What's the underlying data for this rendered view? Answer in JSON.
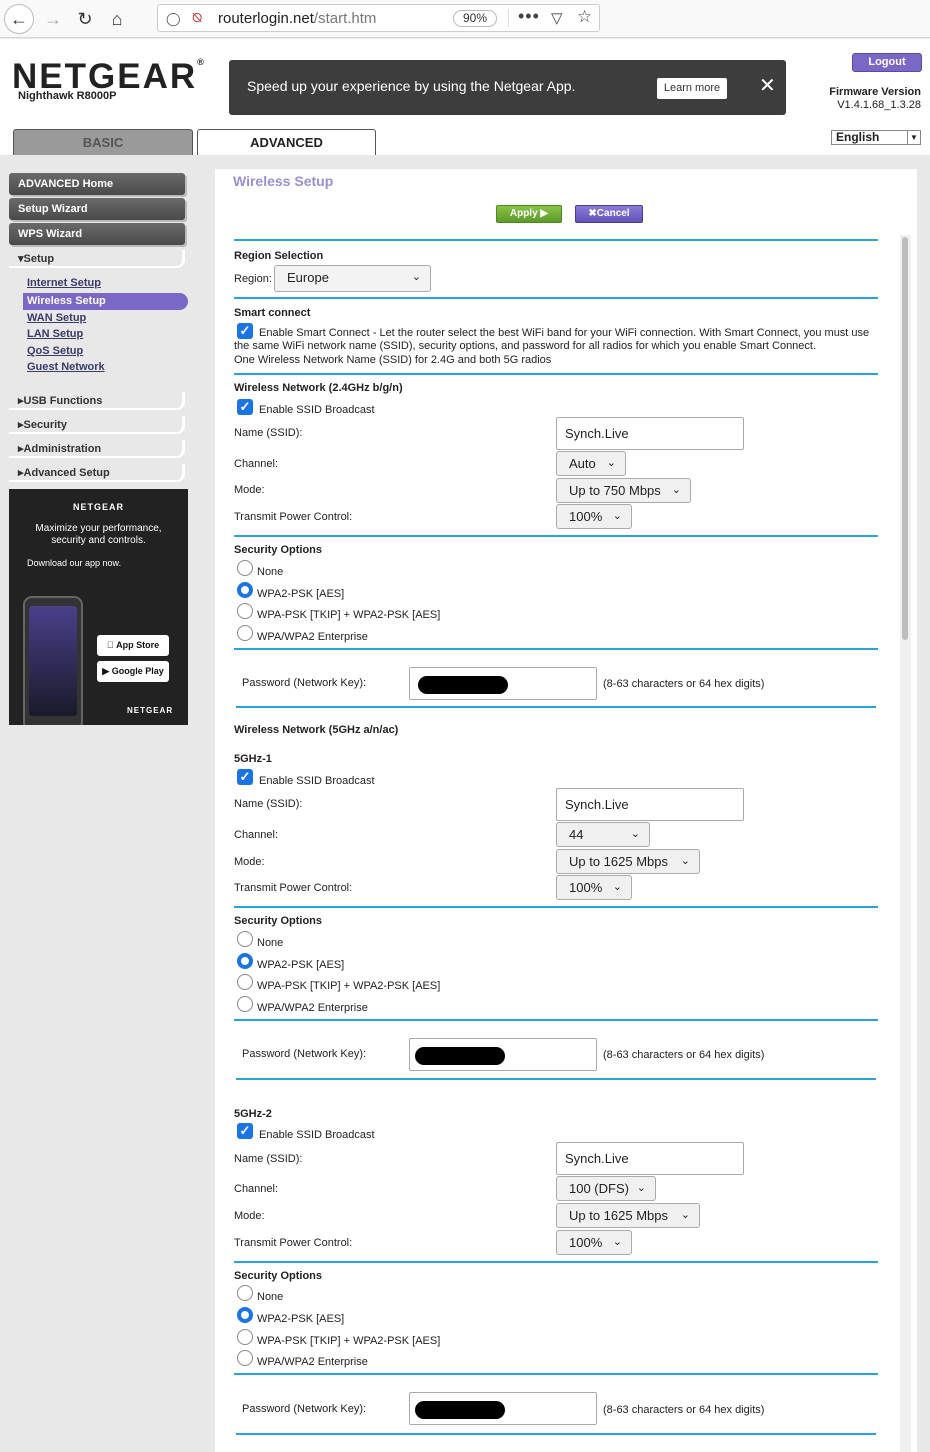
{
  "browser": {
    "url_host": "routerlogin.net",
    "url_path": "/start.htm",
    "zoom": "90%",
    "icons": [
      "back-icon",
      "forward-icon",
      "reload-icon",
      "home-icon",
      "shield-icon",
      "insecure-lock-icon",
      "more-icon",
      "pocket-icon",
      "star-icon"
    ]
  },
  "header": {
    "logo": "NETGEAR",
    "model": "Nighthawk R8000P",
    "banner_text": "Speed up your experience by using the Netgear App.",
    "learn_more": "Learn more",
    "logout": "Logout",
    "firmware_label": "Firmware Version",
    "firmware_version": "V1.4.1.68_1.3.28",
    "tabs": {
      "basic": "BASIC",
      "advanced": "ADVANCED"
    },
    "language": "English"
  },
  "sidebar": {
    "advanced_home": "ADVANCED Home",
    "setup_wizard": "Setup Wizard",
    "wps_wizard": "WPS Wizard",
    "setup": "Setup",
    "setup_items": [
      "Internet Setup",
      "Wireless Setup",
      "WAN Setup",
      "LAN Setup",
      "QoS Setup",
      "Guest Network"
    ],
    "groups": [
      "USB Functions",
      "Security",
      "Administration",
      "Advanced Setup"
    ],
    "ad": {
      "brand": "NETGEAR",
      "text1": "Maximize your performance, security and controls.",
      "text2": "Download our app now.",
      "app_store": "App Store",
      "google_play": "Google Play"
    }
  },
  "main": {
    "title": "Wireless Setup",
    "apply": "Apply",
    "cancel": "Cancel",
    "region_section": "Region Selection",
    "region_label": "Region:",
    "region_value": "Europe",
    "smart_connect_title": "Smart connect",
    "smart_connect_text": "Enable Smart Connect - Let the router select the best WiFi band for your WiFi connection. With Smart Connect, you must use the same WiFi network name (SSID), security options, and password for all radios for which you enable Smart Connect.",
    "smart_connect_note": "One Wireless Network Name (SSID) for 2.4G and both 5G radios",
    "labels": {
      "enable_ssid": "Enable SSID Broadcast",
      "name_ssid": "Name (SSID):",
      "channel": "Channel:",
      "mode": "Mode:",
      "tx_power": "Transmit Power Control:",
      "security_options": "Security Options",
      "password": "Password (Network Key):",
      "password_hint": "(8-63 characters or 64 hex digits)"
    },
    "security_choices": [
      "None",
      "WPA2-PSK [AES]",
      "WPA-PSK [TKIP] + WPA2-PSK [AES]",
      "WPA/WPA2 Enterprise"
    ],
    "net24": {
      "title": "Wireless Network (2.4GHz b/g/n)",
      "ssid": "Synch.Live",
      "channel": "Auto",
      "mode": "Up to 750 Mbps",
      "power": "100%"
    },
    "net5_title": "Wireless Network (5GHz a/n/ac)",
    "net5_1": {
      "title": "5GHz-1",
      "ssid": "Synch.Live",
      "channel": "44",
      "mode": "Up to 1625 Mbps",
      "power": "100%"
    },
    "net5_2": {
      "title": "5GHz-2",
      "ssid": "Synch.Live",
      "channel": "100 (DFS)",
      "mode": "Up to 1625 Mbps",
      "power": "100%"
    }
  }
}
